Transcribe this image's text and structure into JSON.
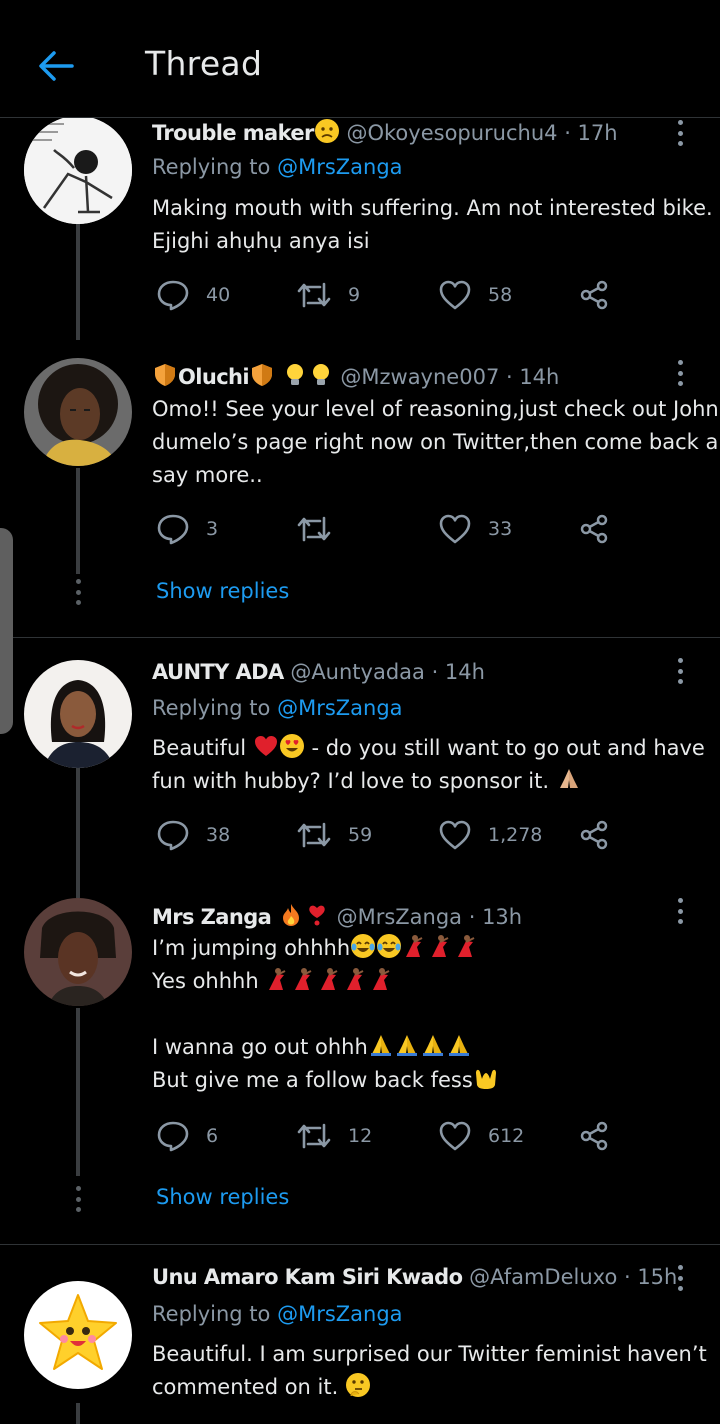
{
  "header": {
    "title": "Thread"
  },
  "tweets": [
    {
      "name": "Trouble maker",
      "handle": "@Okoyesopuruchu4 · 17h",
      "replying_prefix": "Replying to",
      "replying_to": "@MrsZanga",
      "lines": [
        "Making mouth with suffering.  Am not interested bike.",
        "Ejighi ahụhụ anya isi"
      ],
      "replies": "40",
      "retweets": "9",
      "likes": "58"
    },
    {
      "name": "Oluchi",
      "handle": "@Mzwayne007 · 14h",
      "lines": [
        "Omo!! See your level of reasoning,just check out John",
        "dumelo’s page right now on Twitter,then come back and",
        "say more.."
      ],
      "replies": "3",
      "retweets": "",
      "likes": "33",
      "show_replies": "Show replies"
    },
    {
      "name": "AUNTY ADA",
      "handle": "@Auntyadaa · 14h",
      "replying_prefix": "Replying to",
      "replying_to": "@MrsZanga",
      "line1_a": "Beautiful ",
      "line1_b": " - do you still want to go out and have",
      "line2": "fun with hubby? I’d love to sponsor it. ",
      "replies": "38",
      "retweets": "59",
      "likes": "1,278"
    },
    {
      "name": "Mrs Zanga",
      "handle": "@MrsZanga · 13h",
      "line1": "I’m jumping ohhhh",
      "line2": "Yes ohhhh ",
      "line4": "I wanna go out ohhh",
      "line5": "But give me a follow back fess",
      "replies": "6",
      "retweets": "12",
      "likes": "612",
      "show_replies": "Show replies"
    },
    {
      "name": "Unu Amaro Kam Siri Kwado",
      "handle": "@AfamDeluxo · 15h",
      "replying_prefix": "Replying to",
      "replying_to": "@MrsZanga",
      "lines": [
        "Beautiful. I am surprised our Twitter feminist haven’t",
        "commented on it. "
      ]
    }
  ],
  "colors": {
    "accent": "#1d9bf0",
    "muted": "#8b98a5",
    "text": "#e7e9ea",
    "background": "#000000",
    "divider": "#2f3336"
  },
  "icons": [
    "back-arrow-icon",
    "more-icon",
    "reply-icon",
    "retweet-icon",
    "like-icon",
    "share-icon"
  ]
}
